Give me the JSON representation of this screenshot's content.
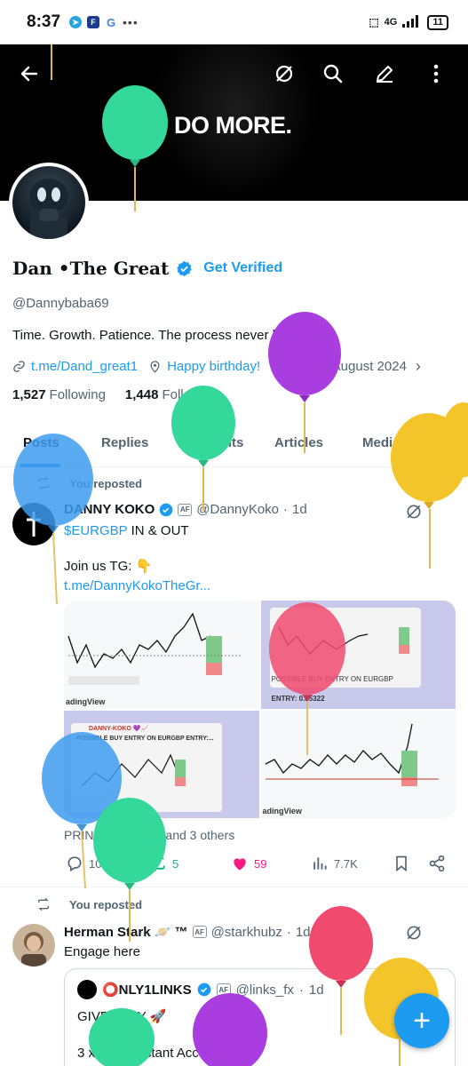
{
  "status_bar": {
    "time": "8:37",
    "network": "4G",
    "battery": "11"
  },
  "banner": {
    "slogan": "DO MORE."
  },
  "header": {
    "back_icon": "arrow-left-icon",
    "menu_icons": [
      "grok-icon",
      "search-icon",
      "edit-icon",
      "more-vertical-icon"
    ]
  },
  "profile": {
    "name": "Dan •The Great",
    "get_verified": "Get Verified",
    "handle": "@Dannybaba69",
    "bio": "Time. Growth. Patience.  The process never lies. ✨",
    "link": "t.me/Dand_great1",
    "birthday": "Happy birthday!",
    "joined": "Joined August 2024",
    "following_count": "1,527",
    "following_label": "Following",
    "followers_count": "1,448",
    "followers_label": "Followers"
  },
  "tabs": [
    "Posts",
    "Replies",
    "Highlights",
    "Articles",
    "Media"
  ],
  "posts": [
    {
      "repost_label": "You reposted",
      "author": "DANNY KOKO",
      "handle": "@DannyKoko",
      "time": "1d",
      "ticker": "$EURGBP",
      "text_line1": " IN & OUT",
      "text_line2": "Join us TG: 👇",
      "link": "t.me/DannyKokoTheGr...",
      "image_captions": {
        "tv": "adingView",
        "possible": "POSSIBLE BUY ENTRY ON EURGBP",
        "entry": "ENTRY: 0.85322",
        "koko": "DANNY-KOKO 💜📈",
        "possible2": "POSSIBLE BUY ENTRY ON EURGBP   ENTRY:..."
      },
      "liked_by": "PRINCE-PAUL👑 and 3 others",
      "stats": {
        "replies": "10",
        "reposts": "5",
        "likes": "59",
        "views": "7.7K"
      }
    },
    {
      "repost_label": "You reposted",
      "author": "Herman Stark 🪐 ™",
      "handle": "@starkhubz",
      "time": "1d",
      "text": "Engage here",
      "quote": {
        "author": "⭕NLY1LINKS",
        "handle": "@links_fx",
        "time": "1d",
        "line1": "GIVEAWAY 🚀",
        "line2": "3 x $10K Instant Accounts"
      }
    }
  ],
  "fab_label": "+",
  "colors": {
    "accent": "#1d9bf0",
    "like": "#f91880",
    "repost": "#00ba7c"
  }
}
